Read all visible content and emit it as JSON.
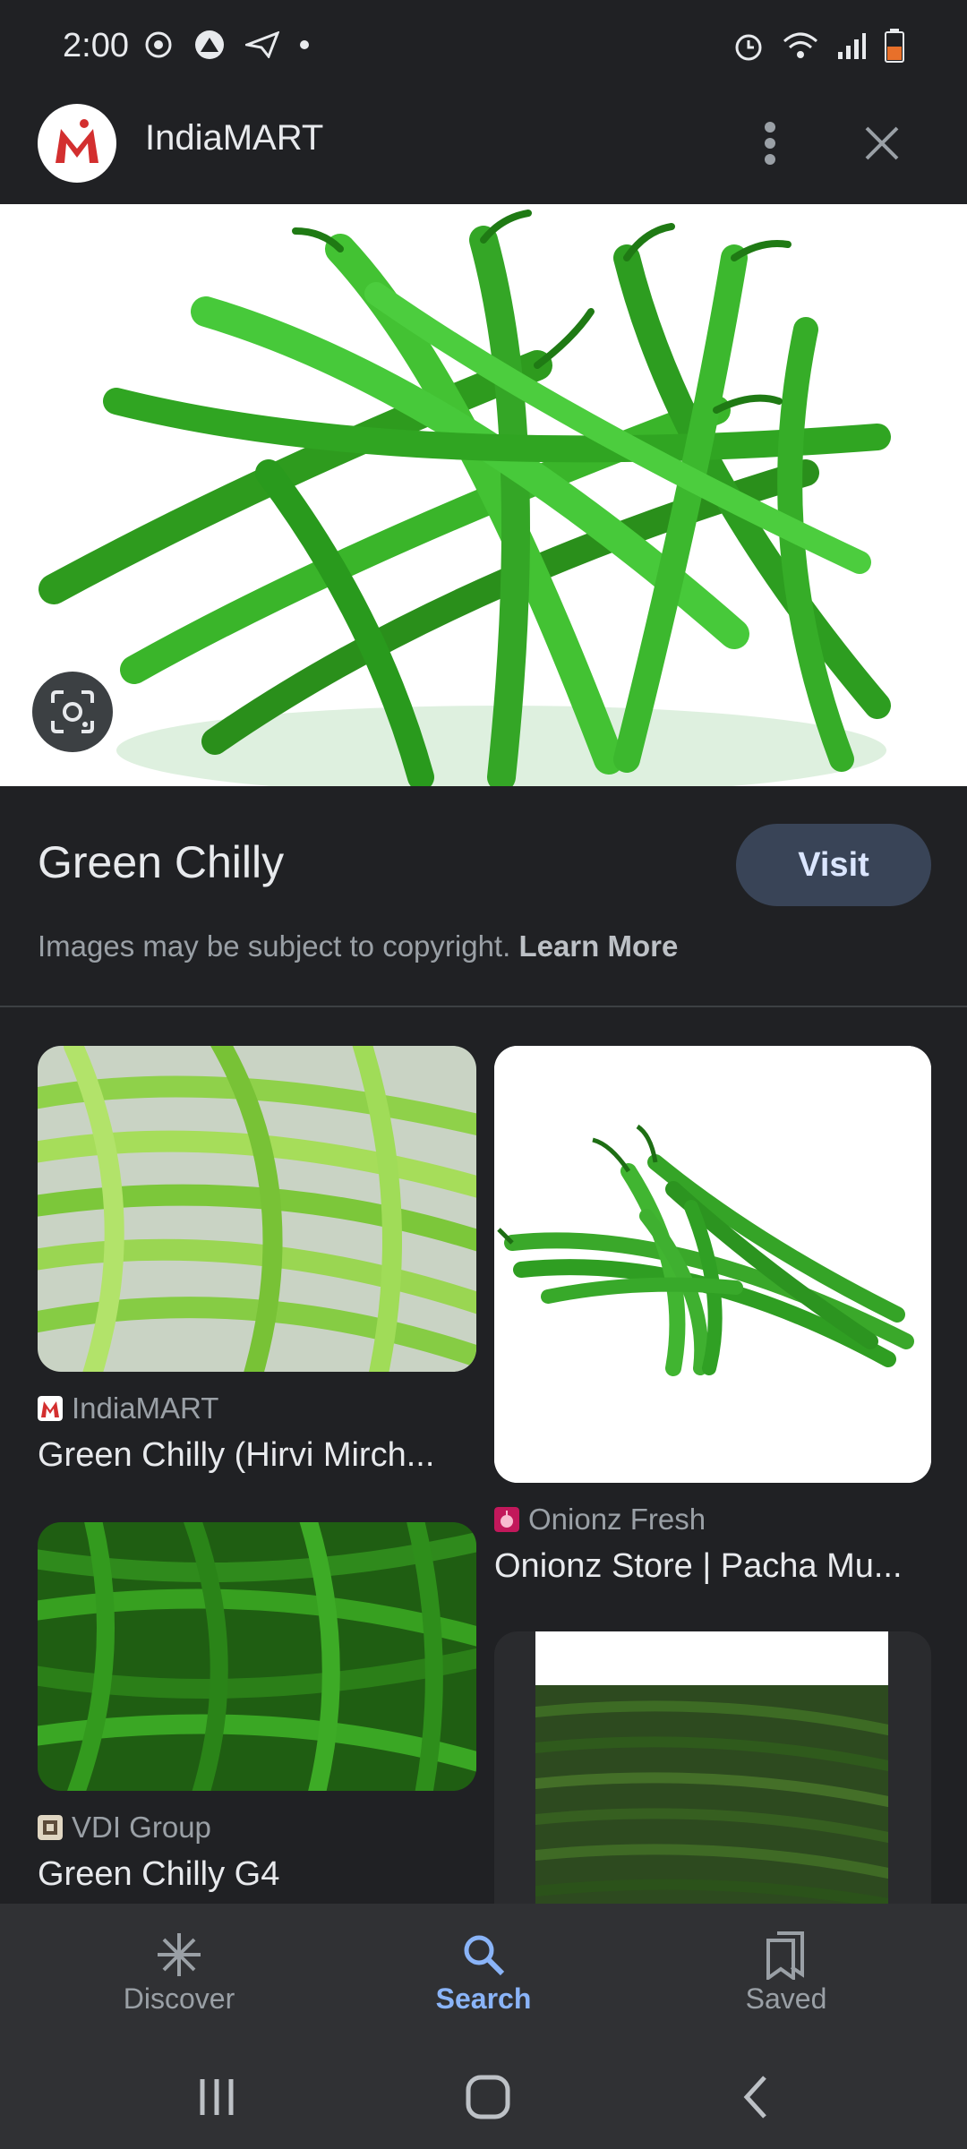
{
  "status": {
    "time": "2:00"
  },
  "appbar": {
    "site_name": "IndiaMART"
  },
  "result": {
    "title": "Green Chilly",
    "visit_label": "Visit",
    "copyright_text": "Images may be subject to copyright.",
    "learn_more": "Learn More"
  },
  "related": [
    {
      "source": "IndiaMART",
      "title": "Green Chilly (Hirvi Mirch..."
    },
    {
      "source": "Onionz Fresh",
      "title": "Onionz Store | Pacha Mu..."
    },
    {
      "source": "VDI Group",
      "title": "Green Chilly G4"
    }
  ],
  "bottom_nav": {
    "discover": "Discover",
    "search": "Search",
    "saved": "Saved"
  },
  "colors": {
    "accent": "#8ab4f8",
    "background": "#202124",
    "visit_button": "#394457"
  }
}
